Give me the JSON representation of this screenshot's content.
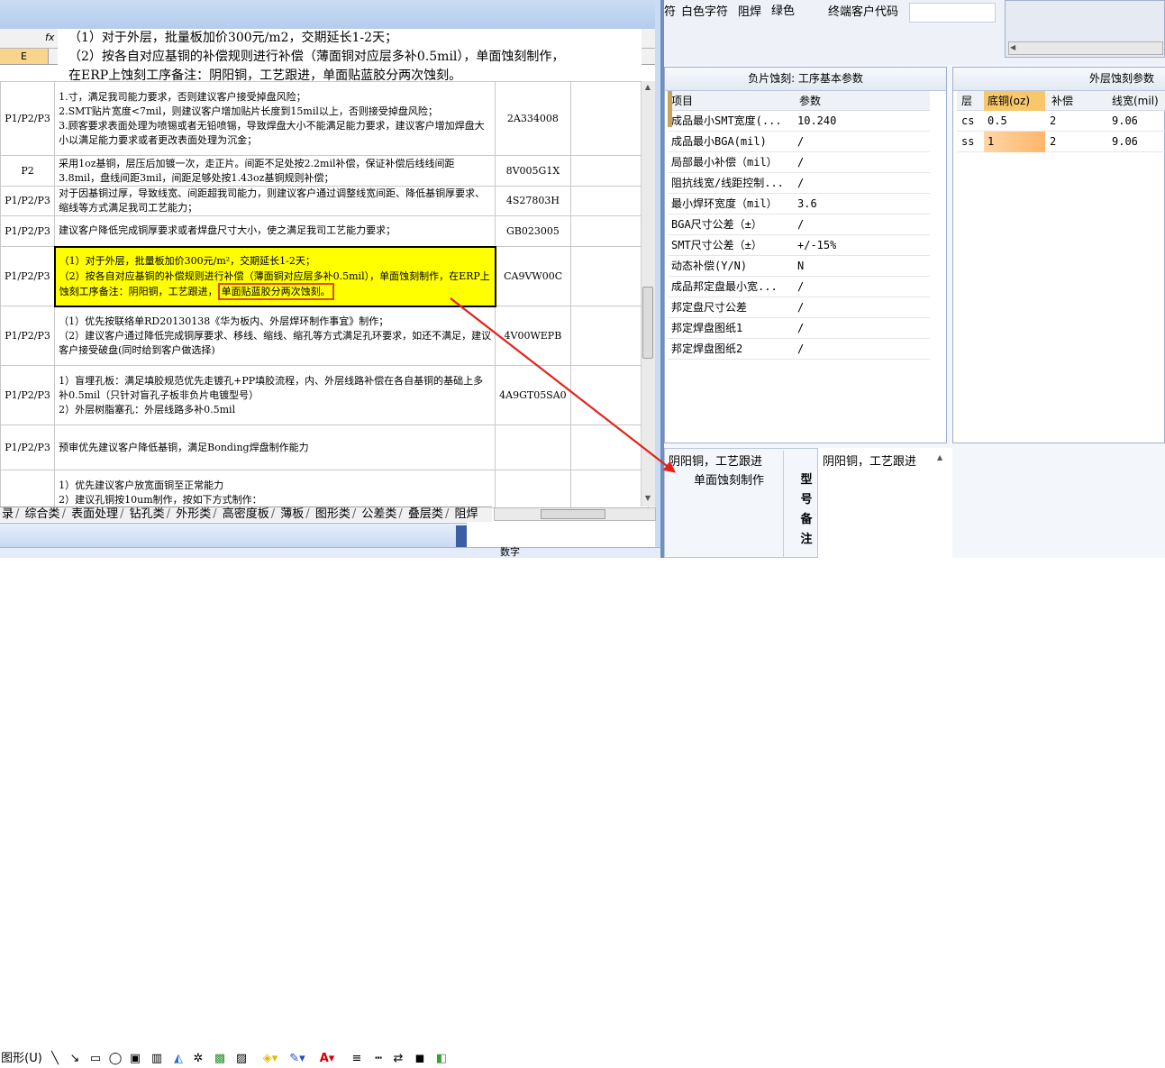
{
  "excel": {
    "fx_label": "fx",
    "column_header": "E",
    "formula_lines": [
      "（1）对于外层，批量板加价300元/m2，交期延长1-2天；",
      "（2）按各自对应基铜的补偿规则进行补偿（薄面铜对应层多补0.5mil），单面蚀刻制作，",
      "在ERP上蚀刻工序备注：阴阳铜，工艺跟进，单面贴蓝胶分两次蚀刻。"
    ],
    "rows": [
      {
        "layer": "P1/P2/P3",
        "text": "1.寸，满足我司能力要求，否则建议客户接受掉盘风险；\n2.SMT贴片宽度<7mil，则建议客户增加贴片长度到15mil以上，否则接受掉盘风险；\n3.顾客要求表面处理为喷锡或者无铅喷锡，导致焊盘大小不能满足能力要求，建议客户增加焊盘大小以满足能力要求或者更改表面处理为沉金；",
        "code": "2A334008"
      },
      {
        "layer": "P2",
        "text": "采用1oz基铜，层压后加镀一次，走正片。间距不足处按2.2mil补偿，保证补偿后线线间距3.8mil，盘线间距3mil，间距足够处按1.43oz基铜规则补偿；",
        "code": "8V005G1X"
      },
      {
        "layer": "P1/P2/P3",
        "text": "对于因基铜过厚，导致线宽、间距超我司能力，则建议客户通过调整线宽间距、降低基铜厚要求、缩线等方式满足我司工艺能力；",
        "code": "4S27803H"
      },
      {
        "layer": "P1/P2/P3",
        "text": "建议客户降低完成铜厚要求或者焊盘尺寸大小，使之满足我司工艺能力要求；",
        "code": "GB023005"
      },
      {
        "layer": "P1/P2/P3",
        "text_a": "（1）对于外层，批量板加价300元/m²，交期延长1-2天；\n（2）按各自对应基铜的补偿规则进行补偿（薄面铜对应层多补0.5mil），单面蚀刻制作，在ERP上蚀刻工序备注：阴阳铜，工艺跟进，",
        "text_b": "单面贴蓝胶分两次蚀刻。",
        "code": "CA9VW00C"
      },
      {
        "layer": "P1/P2/P3",
        "text": "（1）优先按联络单RD20130138《华为板内、外层焊环制作事宜》制作；\n（2）建议客户通过降低完成铜厚要求、移线、缩线、缩孔等方式满足孔环要求，如还不满足，建议客户接受破盘(同时给到客户做选择)",
        "code": "4V00WEPB"
      },
      {
        "layer": "P1/P2/P3",
        "text": "1）盲埋孔板：满足填胶规范优先走镀孔+PP填胶流程，内、外层线路补偿在各自基铜的基础上多补0.5mil（只针对盲孔子板非负片电镀型号）\n2）外层树脂塞孔：外层线路多补0.5mil",
        "code": "4A9GT05SA0"
      },
      {
        "layer": "P1/P2/P3",
        "text": "预审优先建议客户降低基铜，满足Bonding焊盘制作能力",
        "code": ""
      },
      {
        "layer": "",
        "text": "1）优先建议客户放宽面铜至正常能力\n2）建议孔铜按10um制作，按如下方式制作：",
        "code": ""
      }
    ],
    "sheet_tabs": [
      "录",
      "综合类",
      "表面处理",
      "钻孔类",
      "外形类",
      "高密度板",
      "薄板",
      "图形类",
      "公差类",
      "叠层类",
      "阻焊"
    ],
    "draw_toolbar_label": "图形(U)",
    "status_text": "数字"
  },
  "erp": {
    "top_labels": {
      "fu": "符",
      "silk_label": "白色字符",
      "mask_label": "阻焊",
      "mask_color": "绿色",
      "end_customer_label": "终端客户代码"
    },
    "end_customer_value": "",
    "neg_etch_panel": {
      "title": "负片蚀刻: 工序基本参数",
      "headers": [
        "项目",
        "参数"
      ],
      "rows": [
        {
          "name": "成品最小SMT宽度(...",
          "value": "10.240"
        },
        {
          "name": "成品最小BGA(mil)",
          "value": "/"
        },
        {
          "name": "局部最小补偿（mil）",
          "value": "/"
        },
        {
          "name": "阻抗线宽/线距控制...",
          "value": "/"
        },
        {
          "name": "最小焊环宽度（mil）",
          "value": "3.6"
        },
        {
          "name": "BGA尺寸公差（±）",
          "value": "/"
        },
        {
          "name": "SMT尺寸公差（±）",
          "value": "+/-15%"
        },
        {
          "name": "动态补偿(Y/N)",
          "value": "N"
        },
        {
          "name": "成品邦定盘最小宽...",
          "value": "/"
        },
        {
          "name": "邦定盘尺寸公差",
          "value": "/"
        },
        {
          "name": "邦定焊盘图纸1",
          "value": "/"
        },
        {
          "name": "邦定焊盘图纸2",
          "value": "/"
        }
      ]
    },
    "outer_etch_panel": {
      "title": "外层蚀刻参数",
      "headers": [
        "层",
        "底铜(oz)",
        "补偿",
        "线宽(mil)"
      ],
      "rows": [
        {
          "layer": "cs",
          "base": "0.5",
          "comp": "2",
          "width": "9.06"
        },
        {
          "layer": "ss",
          "base": "1",
          "comp": "2",
          "width": "9.06"
        }
      ]
    },
    "remarks": {
      "left_line1": "阴阳铜，工艺跟进",
      "left_line2": "单面蚀刻制作",
      "vertical_label": [
        "型",
        "号",
        "备",
        "注"
      ],
      "right_text": "阴阳铜，工艺跟进"
    }
  }
}
